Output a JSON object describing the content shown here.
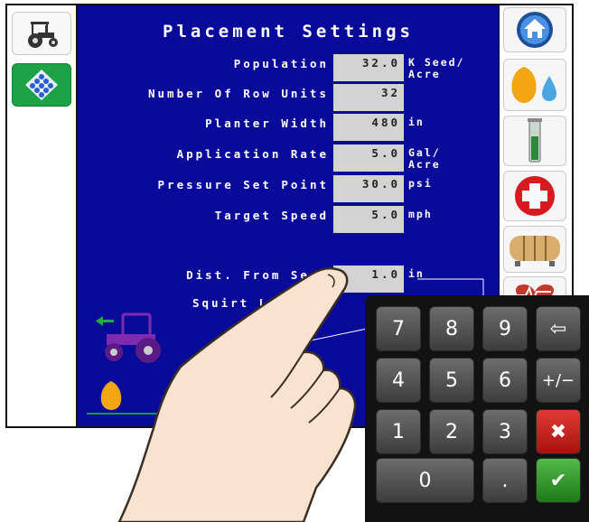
{
  "title": "Placement Settings",
  "fields": [
    {
      "label": "Population",
      "value": "32.0",
      "unit1": "K Seed/",
      "unit2": "Acre"
    },
    {
      "label": "Number Of Row Units",
      "value": "32",
      "unit1": "",
      "unit2": ""
    },
    {
      "label": "Planter Width",
      "value": "480",
      "unit1": "in",
      "unit2": ""
    },
    {
      "label": "Application Rate",
      "value": "5.0",
      "unit1": "Gal/",
      "unit2": "Acre"
    },
    {
      "label": "Pressure Set Point",
      "value": "30.0",
      "unit1": "psi",
      "unit2": ""
    },
    {
      "label": "Target Speed",
      "value": "5.0",
      "unit1": "mph",
      "unit2": ""
    },
    {
      "label": "Dist. From Seed",
      "value": "1.0",
      "unit1": "in",
      "unit2": ""
    },
    {
      "label": "Squirt Le",
      "value": "",
      "unit1": "",
      "unit2": ""
    }
  ],
  "keypad": {
    "k7": "7",
    "k8": "8",
    "k9": "9",
    "backspace": "⇦",
    "k4": "4",
    "k5": "5",
    "k6": "6",
    "plusminus": "+/−",
    "k1": "1",
    "k2": "2",
    "k3": "3",
    "cancel": "✖",
    "k0": "0",
    "dot": ".",
    "ok": "✔"
  },
  "colors": {
    "screen": "#0a0a9a",
    "value_box": "#d3d3d3",
    "settings_button": "#1ea246"
  },
  "icons": {
    "left": [
      "tractor-icon",
      "settings-icon"
    ],
    "right": [
      "home-icon",
      "seed-fertilizer-icon",
      "flow-tube-icon",
      "first-aid-icon",
      "tank-icon",
      "health-monitor-icon"
    ],
    "diagram": [
      "planter-tractor-icon",
      "seed-icon"
    ]
  }
}
